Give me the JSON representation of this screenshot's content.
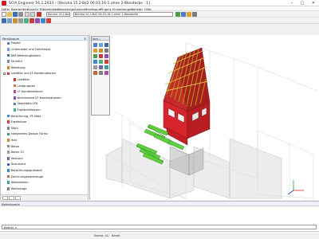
{
  "window": {
    "title": "SCIA Engineer 16.1.2033 – [Beruha 15.2-Bz2 06.03.16-1 ohne 2-Wandecke : 1]",
    "minimize_glyph": "–",
    "maximize_glyph": "□",
    "close_glyph": "✕"
  },
  "menubar": {
    "items": [
      "Datei",
      "Bearbeiten",
      "Ansicht",
      "Bibliotheken",
      "Werkzeuge",
      "Ändern",
      "Menübaum",
      "Plugins",
      "Einstellungen",
      "Fenster",
      "Hilfe"
    ]
  },
  "toolbar": {
    "model_value": "Beruha 15.2-Bz2 0",
    "result_value": "Beruha 15.2-Bz2 06.03.16-1 ohne 2-Wandecke"
  },
  "navigator": {
    "title": "Menübaum",
    "close_glyph": "✕",
    "items": [
      {
        "label": "Projekt",
        "level": 0,
        "expander": "",
        "icon_color": "#4a7fc1"
      },
      {
        "label": "Linienraster und Geschosse",
        "level": 0,
        "expander": "",
        "icon_color": "#6fa0d8"
      },
      {
        "label": "BIM-Werkzeugkasten",
        "level": 0,
        "expander": "",
        "icon_color": "#3d6fb2"
      },
      {
        "label": "Struktur",
        "level": 0,
        "expander": "",
        "icon_color": "#6f8fb5"
      },
      {
        "label": "Belastung",
        "level": 0,
        "expander": "",
        "icon_color": "#d08a2a"
      },
      {
        "label": "Lastfälle und LF-Kombinationen",
        "level": 0,
        "expander": "−",
        "icon_color": "#c63a3a"
      },
      {
        "label": "Lastfälle",
        "level": 1,
        "expander": "",
        "icon_color": "#c63a3a"
      },
      {
        "label": "Lastgruppen",
        "level": 1,
        "expander": "",
        "icon_color": "#d86f3a"
      },
      {
        "label": "LF-Kombinationen",
        "level": 1,
        "expander": "",
        "icon_color": "#b24e9a"
      },
      {
        "label": "Nichtlineare LF-Kombinationen",
        "level": 1,
        "expander": "",
        "icon_color": "#8a4eb2"
      },
      {
        "label": "Stabilitäts-LFK",
        "level": 1,
        "expander": "",
        "icon_color": "#4e7fb2"
      },
      {
        "label": "Ergebnisklassen",
        "level": 1,
        "expander": "",
        "icon_color": "#4eb27f"
      },
      {
        "label": "Berechnung, FE-Netz",
        "level": 0,
        "expander": "",
        "icon_color": "#3a8ad0"
      },
      {
        "label": "Ergebnisse",
        "level": 0,
        "expander": "",
        "icon_color": "#d0403a"
      },
      {
        "label": "Stahl",
        "level": 0,
        "expander": "",
        "icon_color": "#7a8a9a"
      },
      {
        "label": "Integriertes Design Forms",
        "level": 0,
        "expander": "",
        "icon_color": "#3a9a6a"
      },
      {
        "label": "Holz",
        "level": 0,
        "expander": "",
        "icon_color": "#c8902a"
      },
      {
        "label": "Beton",
        "level": 0,
        "expander": "",
        "icon_color": "#8a8a8a"
      },
      {
        "label": "Beton 15",
        "level": 0,
        "expander": "",
        "icon_color": "#9a9a9a"
      },
      {
        "label": "Verbund",
        "level": 0,
        "expander": "",
        "icon_color": "#6a6aaa"
      },
      {
        "label": "Dokument",
        "level": 0,
        "expander": "",
        "icon_color": "#3a6ac0"
      },
      {
        "label": "Berechnungsprotokoll",
        "level": 0,
        "expander": "",
        "icon_color": "#3a8ac0"
      },
      {
        "label": "Zeichnungswerkzeuge",
        "level": 0,
        "expander": "",
        "icon_color": "#c06a3a"
      },
      {
        "label": "Bibliotheken",
        "level": 0,
        "expander": "",
        "icon_color": "#3aa0a0"
      },
      {
        "label": "Werkzeuge",
        "level": 0,
        "expander": "",
        "icon_color": "#808080"
      }
    ]
  },
  "panel": {
    "title": "Ansi..."
  },
  "console": {
    "title": "Befehlszeile",
    "command": "Befehl >"
  },
  "statusbar": {
    "items": [
      "Ebene: 01",
      "Bereit"
    ]
  },
  "colors": {
    "accent": "#c8202a",
    "roof": "#c62a2a",
    "timber": "#e6c24a",
    "stair": "#5fcf3f",
    "wall": "#d7262b",
    "ghost": "#b8b8b8"
  }
}
